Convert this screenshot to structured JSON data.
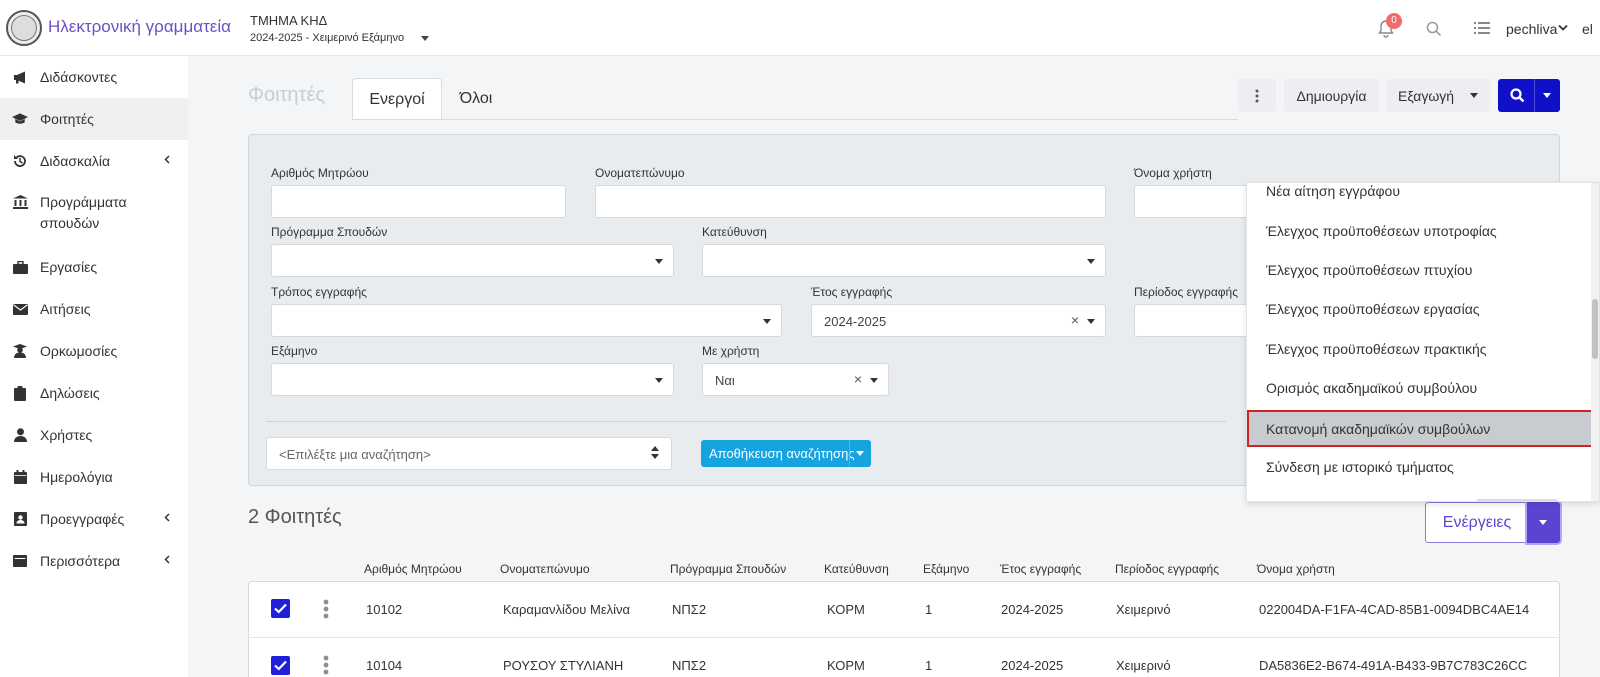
{
  "header": {
    "app_title": "Ηλεκτρονική γραμματεία",
    "department": "ΤΜΗΜΑ ΚΗΔ",
    "period": "2024-2025 - Χειμερινό Εξάμηνο",
    "notifications_count": "0",
    "username": "pechliva",
    "language": "el"
  },
  "sidebar": {
    "items": [
      {
        "label": "Διδάσκοντες",
        "icon": "megaphone-icon"
      },
      {
        "label": "Φοιτητές",
        "icon": "graduation-cap-icon"
      },
      {
        "label": "Διδασκαλία",
        "icon": "history-icon"
      },
      {
        "label": "Προγράμματα σπουδών",
        "icon": "institution-icon"
      },
      {
        "label": "Εργασίες",
        "icon": "briefcase-icon"
      },
      {
        "label": "Αιτήσεις",
        "icon": "envelope-icon"
      },
      {
        "label": "Ορκωμοσίες",
        "icon": "graduate-user-icon"
      },
      {
        "label": "Δηλώσεις",
        "icon": "clipboard-icon"
      },
      {
        "label": "Χρήστες",
        "icon": "user-icon"
      },
      {
        "label": "Ημερολόγια",
        "icon": "calendar-icon"
      },
      {
        "label": "Προεγγραφές",
        "icon": "address-book-icon"
      },
      {
        "label": "Περισσότερα",
        "icon": "window-icon"
      }
    ]
  },
  "page": {
    "title": "Φοιτητές",
    "tabs": [
      {
        "label": "Ενεργοί"
      },
      {
        "label": "Όλοι"
      }
    ],
    "create_label": "Δημιουργία",
    "export_label": "Εξαγωγή"
  },
  "filters": {
    "student_number": {
      "label": "Αριθμός Μητρώου",
      "value": ""
    },
    "full_name": {
      "label": "Ονοματεπώνυμο",
      "value": ""
    },
    "username": {
      "label": "Όνομα χρήστη",
      "value": ""
    },
    "study_program": {
      "label": "Πρόγραμμα Σπουδών",
      "value": ""
    },
    "direction": {
      "label": "Κατεύθυνση",
      "value": ""
    },
    "registration_type": {
      "label": "Τρόπος εγγραφής",
      "value": ""
    },
    "registration_year": {
      "label": "Έτος εγγραφής",
      "value": "2024-2025"
    },
    "registration_period": {
      "label": "Περίοδος εγγραφής",
      "value": ""
    },
    "semester": {
      "label": "Εξάμηνο",
      "value": ""
    },
    "has_user": {
      "label": "Με χρήστη",
      "value": "Ναι"
    },
    "saved_search_placeholder": "<Επιλέξτε μια αναζήτηση>",
    "save_search_label": "Αποθήκευση αναζήτησης"
  },
  "results": {
    "count_label": "2 Φοιτητές",
    "actions_label": "Ενέργειες",
    "columns": [
      "Αριθμός Μητρώου",
      "Ονοματεπώνυμο",
      "Πρόγραμμα Σπουδών",
      "Κατεύθυνση",
      "Εξάμηνο",
      "Έτος εγγραφής",
      "Περίοδος εγγραφής",
      "Όνομα χρήστη"
    ],
    "rows": [
      {
        "number": "10102",
        "name": "Καραμανλίδου Μελίνα",
        "program": "ΝΠΣ2",
        "direction": "ΚΟΡΜ",
        "semester": "1",
        "year": "2024-2025",
        "period": "Χειμερινό",
        "username": "022004DA-F1FA-4CAD-85B1-0094DBC4AE14",
        "checked": true
      },
      {
        "number": "10104",
        "name": "ΡΟΥΣΟΥ ΣΤΥΛΙΑΝΗ",
        "program": "ΝΠΣ2",
        "direction": "ΚΟΡΜ",
        "semester": "1",
        "year": "2024-2025",
        "period": "Χειμερινό",
        "username": "DA5836E2-B674-491A-B433-9B7C783C26CC",
        "checked": true
      }
    ]
  },
  "actions_menu": {
    "items": [
      {
        "label": "Νέα αίτηση εγγράφου"
      },
      {
        "label": "Έλεγχος προϋποθέσεων υποτροφίας"
      },
      {
        "label": "Έλεγχος προϋποθέσεων πτυχίου"
      },
      {
        "label": "Έλεγχος προϋποθέσεων εργασίας"
      },
      {
        "label": "Έλεγχος προϋποθέσεων πρακτικής"
      },
      {
        "label": "Ορισμός ακαδημαϊκού συμβούλου"
      },
      {
        "label": "Κατανομή ακαδημαϊκών συμβούλων",
        "highlighted": true
      },
      {
        "label": "Σύνδεση με ιστορικό τμήματος"
      }
    ]
  },
  "colors": {
    "brand": "#6c4fc7",
    "primary": "#1010c8",
    "info": "#17a2e0",
    "actions": "#5b45d0",
    "highlight_border": "#d42020"
  }
}
